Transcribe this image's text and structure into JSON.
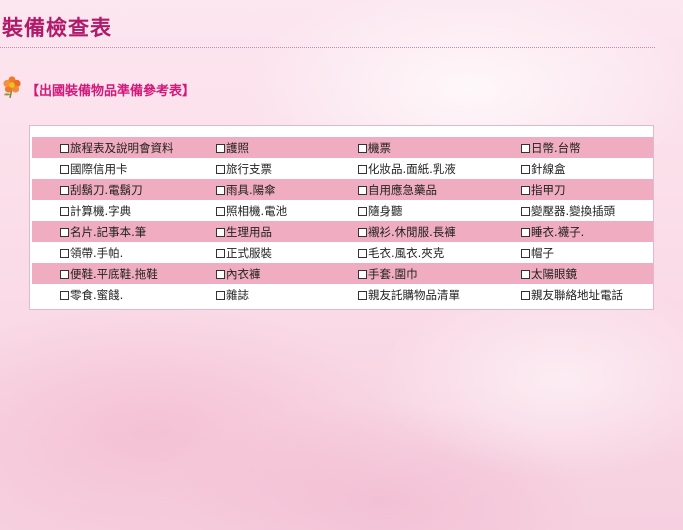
{
  "page": {
    "title": "裝備檢查表",
    "section_heading": "【出國裝備物品準備參考表】"
  },
  "checklist": {
    "rows": [
      [
        "旅程表及說明會資料",
        "護照",
        "機票",
        "日幣.台幣"
      ],
      [
        "國際信用卡",
        "旅行支票",
        "化妝品.面紙.乳液",
        "針線盒"
      ],
      [
        "刮鬍刀.電鬍刀",
        "雨具.陽傘",
        "自用應急藥品",
        "指甲刀"
      ],
      [
        "計算機.字典",
        "照相機.電池",
        "隨身聽",
        "變壓器.變換插頭"
      ],
      [
        "名片.記事本.筆",
        "生理用品",
        "襯衫.休閒服.長褲",
        "睡衣.襪子."
      ],
      [
        "領帶.手帕.",
        "正式服裝",
        "毛衣.風衣.夾克",
        "帽子"
      ],
      [
        "便鞋.平底鞋.拖鞋",
        "內衣褲",
        "手套.圍巾",
        "太陽眼鏡"
      ],
      [
        "零食.蜜餞.",
        "雜誌",
        "親友託購物品清單",
        "親友聯絡地址電話"
      ]
    ]
  },
  "colors": {
    "title": "#b01a6a",
    "heading": "#d0197a",
    "row_shade": "#f0acc0"
  }
}
